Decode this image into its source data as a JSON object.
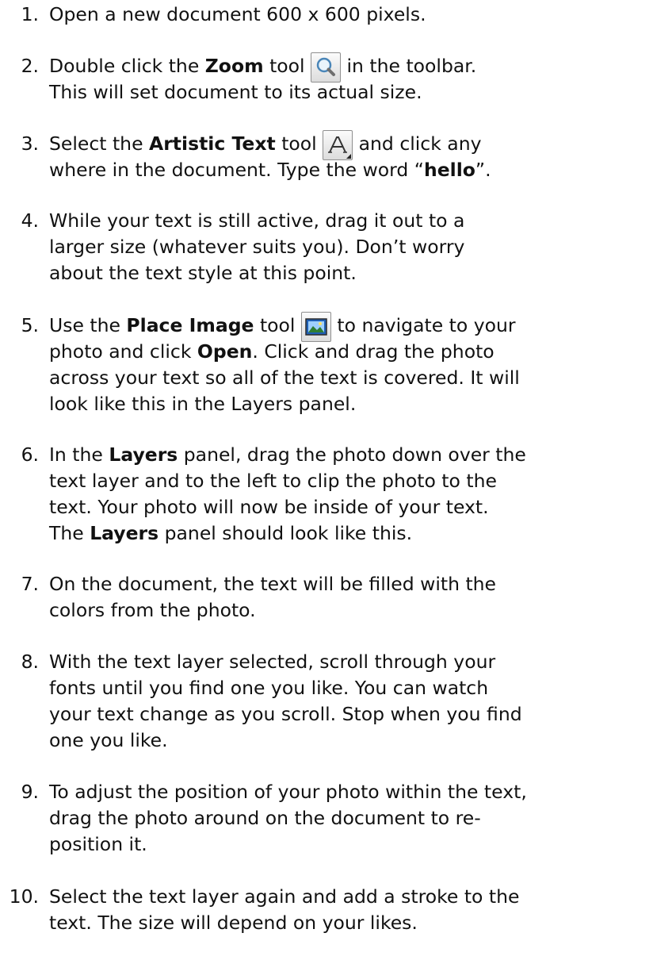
{
  "steps": [
    {
      "num": "1.",
      "parts": {
        "a": "Open a new document 600 x 600 pixels."
      }
    },
    {
      "num": "2.",
      "parts": {
        "a": "Double click  the ",
        "b": "Zoom",
        "c": " tool ",
        "d": " in the toolbar.",
        "e": "This will set document to its actual size."
      }
    },
    {
      "num": "3.",
      "parts": {
        "a": "Select the ",
        "b": "Artistic Text",
        "c": " tool ",
        "d": " and click any",
        "e": "where in the document.  Type the word “",
        "f": "hello",
        "g": "”."
      }
    },
    {
      "num": "4.",
      "parts": {
        "a": "While your text is still active,  drag it out to a",
        "b": "larger size (whatever suits you).  Don’t worry",
        "c": "about the text style at this point."
      }
    },
    {
      "num": "5.",
      "parts": {
        "a": "Use the ",
        "b": "Place Image",
        "c": " tool ",
        "d": " to navigate to your",
        "e": "photo and click ",
        "f": "Open",
        "g": ". Click and drag the photo",
        "h": "across your text so all of the text is covered.  It will",
        "i": "look like this in the Layers panel."
      }
    },
    {
      "num": "6.",
      "parts": {
        "a": "In the ",
        "b": "Layers",
        "c": " panel, drag the photo down over the",
        "d": "text layer and to the left to clip the photo to the",
        "e": "text.  Your photo will now be inside of your text.",
        "f": "The ",
        "g": "Layers",
        "h": " panel should look like this."
      }
    },
    {
      "num": "7.",
      "parts": {
        "a": "On the document, the text will be filled with the",
        "b": "colors from the photo."
      }
    },
    {
      "num": "8.",
      "parts": {
        "a": "With the text layer selected,  scroll through your",
        "b": "fonts until you find one you like.  You can watch",
        "c": "your text change as you scroll.  Stop when you find",
        "d": "one you like."
      }
    },
    {
      "num": "9.",
      "parts": {
        "a": "To adjust the position of your photo within the text,",
        "b": "drag the photo around on the document to re-",
        "c": "position it."
      }
    },
    {
      "num": "10.",
      "parts": {
        "a": "Select the text layer again and add a stroke to the",
        "b": "text. The size will depend on your likes."
      }
    }
  ],
  "icons": {
    "zoom": "zoom-tool-icon",
    "artistic_text": "artistic-text-tool-icon",
    "place_image": "place-image-tool-icon"
  },
  "colors": {
    "text": "#111111",
    "icon_border": "#8f8f8f",
    "place_image_blue": "#1f5fb4"
  }
}
